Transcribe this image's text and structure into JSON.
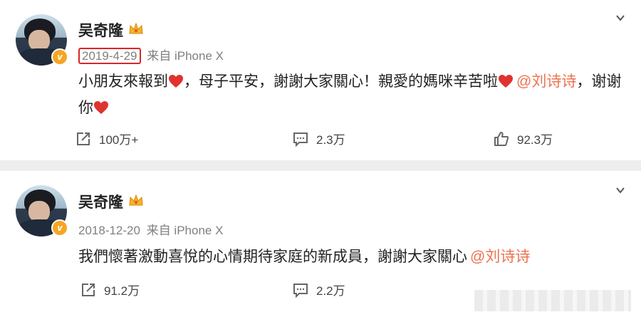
{
  "posts": [
    {
      "author": "吴奇隆",
      "date": "2019-4-29",
      "source": "来自 iPhone X",
      "content_parts": [
        "小朋友來報到",
        "，母子平安，謝謝大家關心！親愛的媽咪辛苦啦",
        "@刘诗诗",
        "，谢谢你"
      ],
      "actions": {
        "repost": "100万+",
        "comment": "2.3万",
        "like": "92.3万"
      }
    },
    {
      "author": "吴奇隆",
      "date": "2018-12-20",
      "source": "来自 iPhone X",
      "content_parts": [
        "我們懷著激動喜悅的心情期待家庭的新成員，謝謝大家關心",
        "@刘诗诗"
      ],
      "actions": {
        "repost": "91.2万",
        "comment": "2.2万"
      }
    }
  ],
  "colors": {
    "mention": "#eb7350",
    "highlight_box": "#d9262b",
    "verified_badge": "#f5a623",
    "heart": "#e0332f"
  },
  "icons": [
    "verified-v-icon",
    "crown-icon",
    "chevron-down-icon",
    "heart-icon",
    "repost-icon",
    "comment-icon",
    "like-icon"
  ]
}
